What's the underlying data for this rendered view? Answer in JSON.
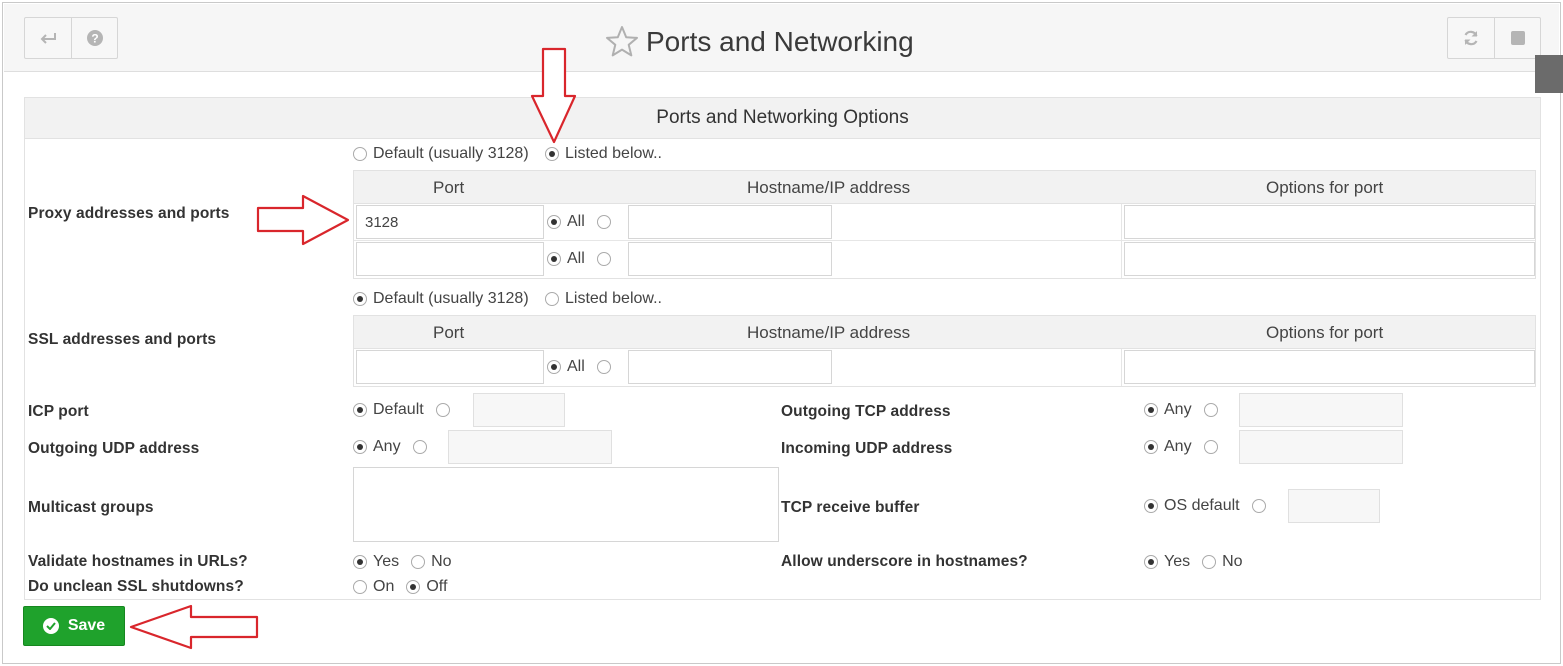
{
  "header": {
    "title": "Ports and Networking"
  },
  "panel": {
    "title": "Ports and Networking Options"
  },
  "proxy": {
    "label": "Proxy addresses and ports",
    "mode_default": "Default (usually 3128)",
    "mode_listed": "Listed below..",
    "columns": [
      "Port",
      "Hostname/IP address",
      "Options for port"
    ],
    "rows": [
      {
        "port": "3128",
        "all_label": "All",
        "host": "",
        "options": ""
      },
      {
        "port": "",
        "all_label": "All",
        "host": "",
        "options": ""
      }
    ]
  },
  "ssl": {
    "label": "SSL addresses and ports",
    "mode_default": "Default (usually 3128)",
    "mode_listed": "Listed below..",
    "columns": [
      "Port",
      "Hostname/IP address",
      "Options for port"
    ],
    "rows": [
      {
        "port": "",
        "all_label": "All",
        "host": "",
        "options": ""
      }
    ]
  },
  "icp": {
    "label": "ICP port",
    "option": "Default"
  },
  "outgoing_tcp": {
    "label": "Outgoing TCP address",
    "option": "Any"
  },
  "outgoing_udp": {
    "label": "Outgoing UDP address",
    "option": "Any"
  },
  "incoming_udp": {
    "label": "Incoming UDP address",
    "option": "Any"
  },
  "multicast": {
    "label": "Multicast groups"
  },
  "tcp_buffer": {
    "label": "TCP receive buffer",
    "option": "OS default"
  },
  "validate": {
    "label": "Validate hostnames in URLs?",
    "yes": "Yes",
    "no": "No"
  },
  "underscore": {
    "label": "Allow underscore in hostnames?",
    "yes": "Yes",
    "no": "No"
  },
  "unclean": {
    "label": "Do unclean SSL shutdowns?",
    "on": "On",
    "off": "Off"
  },
  "save": {
    "label": "Save"
  },
  "colors": {
    "save_green": "#1fa22c",
    "annotation_red": "#d9262c"
  }
}
